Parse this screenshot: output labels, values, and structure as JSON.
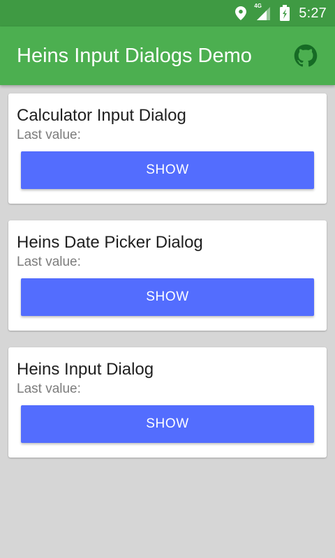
{
  "status_bar": {
    "network": "4G",
    "time": "5:27",
    "icons": [
      "location-icon",
      "signal-icon",
      "battery-icon"
    ]
  },
  "app_bar": {
    "title": "Heins Input Dialogs Demo",
    "action_icon": "github-icon"
  },
  "cards": [
    {
      "title": "Calculator Input Dialog",
      "subtitle": "Last value:",
      "button": "SHOW"
    },
    {
      "title": "Heins Date Picker Dialog",
      "subtitle": "Last value:",
      "button": "SHOW"
    },
    {
      "title": "Heins Input Dialog",
      "subtitle": "Last value:",
      "button": "SHOW"
    }
  ],
  "colors": {
    "status_bar": "#3f9a43",
    "app_bar": "#4caf50",
    "button": "#536dfe",
    "background": "#d6d6d6",
    "card": "#ffffff"
  }
}
